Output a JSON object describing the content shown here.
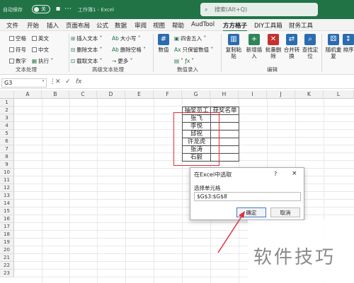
{
  "titlebar": {
    "autosave": "自动保存",
    "toggle": "关",
    "workbook": "工作簿1 - Excel",
    "search_placeholder": "搜索(Alt+Q)"
  },
  "menu": [
    "文件",
    "开始",
    "插入",
    "页面布局",
    "公式",
    "数据",
    "审阅",
    "视图",
    "帮助",
    "AudTool",
    "方方格子",
    "DIY工具箱",
    "财务工具"
  ],
  "ribbon": {
    "checks": [
      "空格",
      "英文",
      "符号",
      "中文",
      "数字",
      "执行"
    ],
    "text_tools": [
      "插入文本",
      "删除文本",
      "截取文本",
      "大小写",
      "删除空格",
      "更多"
    ],
    "round": [
      "四舍五入",
      "只保留数值",
      "数值"
    ],
    "big_buttons": [
      "复制粘贴",
      "新增插入",
      "批量删除",
      "合并转换",
      "查找定位",
      "随机重复",
      "排序"
    ],
    "groups": [
      "文本处理",
      "高级文本处理",
      "数值录入",
      "编辑"
    ]
  },
  "formula_bar": {
    "name_box": "G3",
    "fx": "fx"
  },
  "columns": [
    "A",
    "B",
    "C",
    "D",
    "E",
    "F",
    "G",
    "H",
    "I",
    "J",
    "K",
    "L"
  ],
  "rows": [
    "1",
    "2",
    "3",
    "4",
    "5",
    "6",
    "7",
    "8",
    "9",
    "10",
    "11",
    "12",
    "13",
    "14",
    "15",
    "16",
    "17",
    "18",
    "19",
    "20",
    "21",
    "22",
    "23"
  ],
  "table": {
    "header_g": "抽奖员工",
    "header_h": "获奖名单",
    "names": [
      "张飞",
      "李悦",
      "邱祝",
      "许龙虎",
      "张涛",
      "石毅"
    ]
  },
  "dialog": {
    "title": "在Excel中选取",
    "question": "?",
    "close": "×",
    "label": "选择单元格",
    "value": "$G$3:$G$8",
    "ok": "确定",
    "cancel": "取消"
  },
  "watermark": "软件技巧"
}
